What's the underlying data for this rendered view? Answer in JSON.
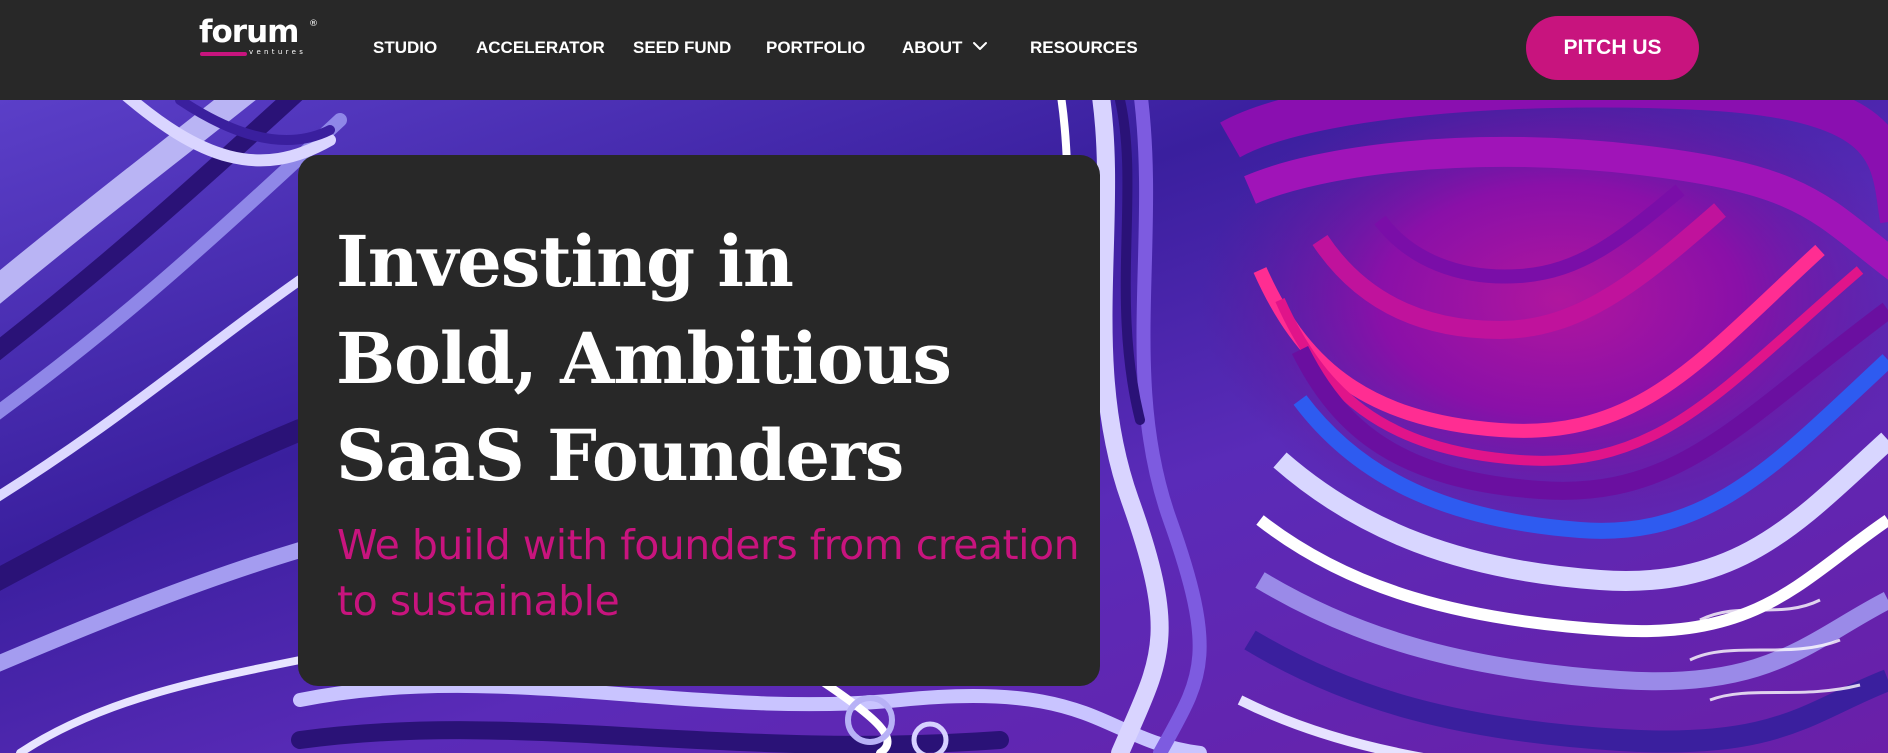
{
  "logo": {
    "wordmark": "forum",
    "registered": "®",
    "tagline": "ventures"
  },
  "nav": {
    "items": [
      {
        "label": "STUDIO"
      },
      {
        "label": "ACCELERATOR"
      },
      {
        "label": "SEED FUND"
      },
      {
        "label": "PORTFOLIO"
      },
      {
        "label": "ABOUT",
        "has_dropdown": true
      },
      {
        "label": "RESOURCES"
      }
    ],
    "dropdown_icon": "chevron-down-icon",
    "cta_label": "PITCH US"
  },
  "hero": {
    "headline_lines": [
      "Investing in",
      "Bold, Ambitious",
      "SaaS Founders"
    ],
    "subheadline_lines": [
      "We build with founders from creation",
      "to sustainable"
    ]
  },
  "colors": {
    "navbar_bg": "#282828",
    "card_bg": "#282828",
    "accent": "#c8147e",
    "text": "#ffffff"
  }
}
